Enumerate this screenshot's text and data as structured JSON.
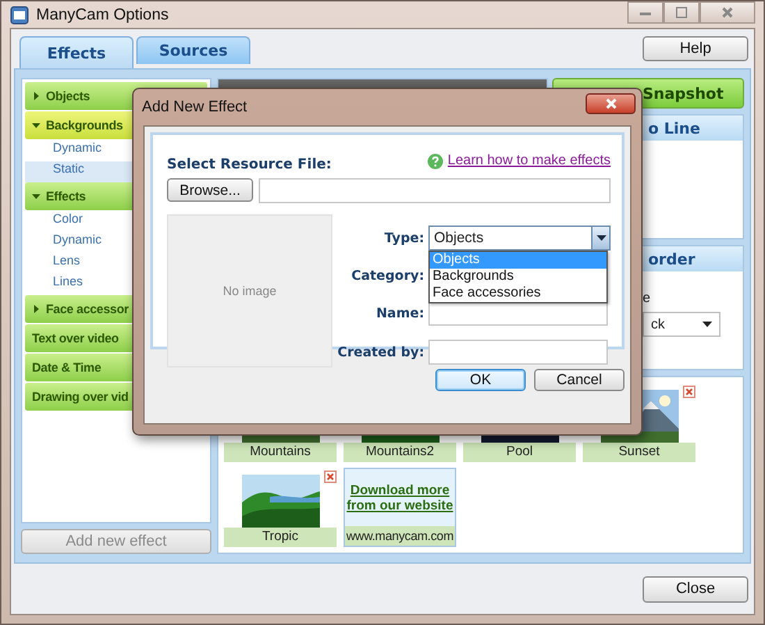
{
  "window": {
    "title": "ManyCam Options"
  },
  "help_button": {
    "label": "Help"
  },
  "tabs": [
    {
      "label": "Effects",
      "selected": true
    },
    {
      "label": "Sources",
      "selected": false
    }
  ],
  "sidebar": {
    "groups": [
      {
        "label": "Objects",
        "expandable": true,
        "expanded": false,
        "selected": false
      },
      {
        "label": "Backgrounds",
        "expandable": true,
        "expanded": true,
        "selected": true,
        "children": [
          {
            "label": "Dynamic",
            "selected": false
          },
          {
            "label": "Static",
            "selected": true
          }
        ]
      },
      {
        "label": "Effects",
        "expandable": true,
        "expanded": true,
        "selected": false,
        "children": [
          {
            "label": "Color",
            "selected": false
          },
          {
            "label": "Dynamic",
            "selected": false
          },
          {
            "label": "Lens",
            "selected": false
          },
          {
            "label": "Lines",
            "selected": false
          }
        ]
      },
      {
        "label": "Face accessor",
        "expandable": true,
        "expanded": false,
        "selected": false
      },
      {
        "label": "Text over video",
        "expandable": false,
        "selected": false
      },
      {
        "label": "Date & Time",
        "expandable": false,
        "selected": false
      },
      {
        "label": "Drawing over vid",
        "expandable": false,
        "selected": false
      }
    ]
  },
  "add_button": {
    "label": "Add new effect",
    "disabled": true
  },
  "snapshot_button": {
    "label": "Snapshot"
  },
  "panels": [
    {
      "header": "o Line"
    },
    {
      "header": "order",
      "label": "e",
      "dropdown_value": "ck"
    }
  ],
  "gallery": [
    {
      "label": "Mountains",
      "kind": "picture"
    },
    {
      "label": "Mountains2",
      "kind": "picture"
    },
    {
      "label": "Pool",
      "kind": "picture"
    },
    {
      "label": "Sunset",
      "kind": "picture",
      "removable": true
    },
    {
      "label": "Tropic",
      "kind": "picture",
      "removable": true
    },
    {
      "label": "www.manycam.com",
      "kind": "link",
      "link_text": "Download more from our website"
    }
  ],
  "close_button": {
    "label": "Close"
  },
  "dialog": {
    "title": "Add New Effect",
    "resource_label": "Select Resource File:",
    "help_link": "Learn how to make effects",
    "browse_button": "Browse...",
    "preview_text": "No image",
    "fields": [
      {
        "label": "Type:",
        "kind": "combo",
        "value": "Objects"
      },
      {
        "label": "Category:",
        "kind": "covered"
      },
      {
        "label": "Name:",
        "kind": "text"
      },
      {
        "label": "Created by:",
        "kind": "text"
      }
    ],
    "dropdown_options": [
      {
        "label": "Objects",
        "selected": true
      },
      {
        "label": "Backgrounds",
        "selected": false
      },
      {
        "label": "Face accessories",
        "selected": false
      }
    ],
    "buttons": [
      {
        "label": "OK",
        "default": true
      },
      {
        "label": "Cancel",
        "default": false
      }
    ]
  }
}
